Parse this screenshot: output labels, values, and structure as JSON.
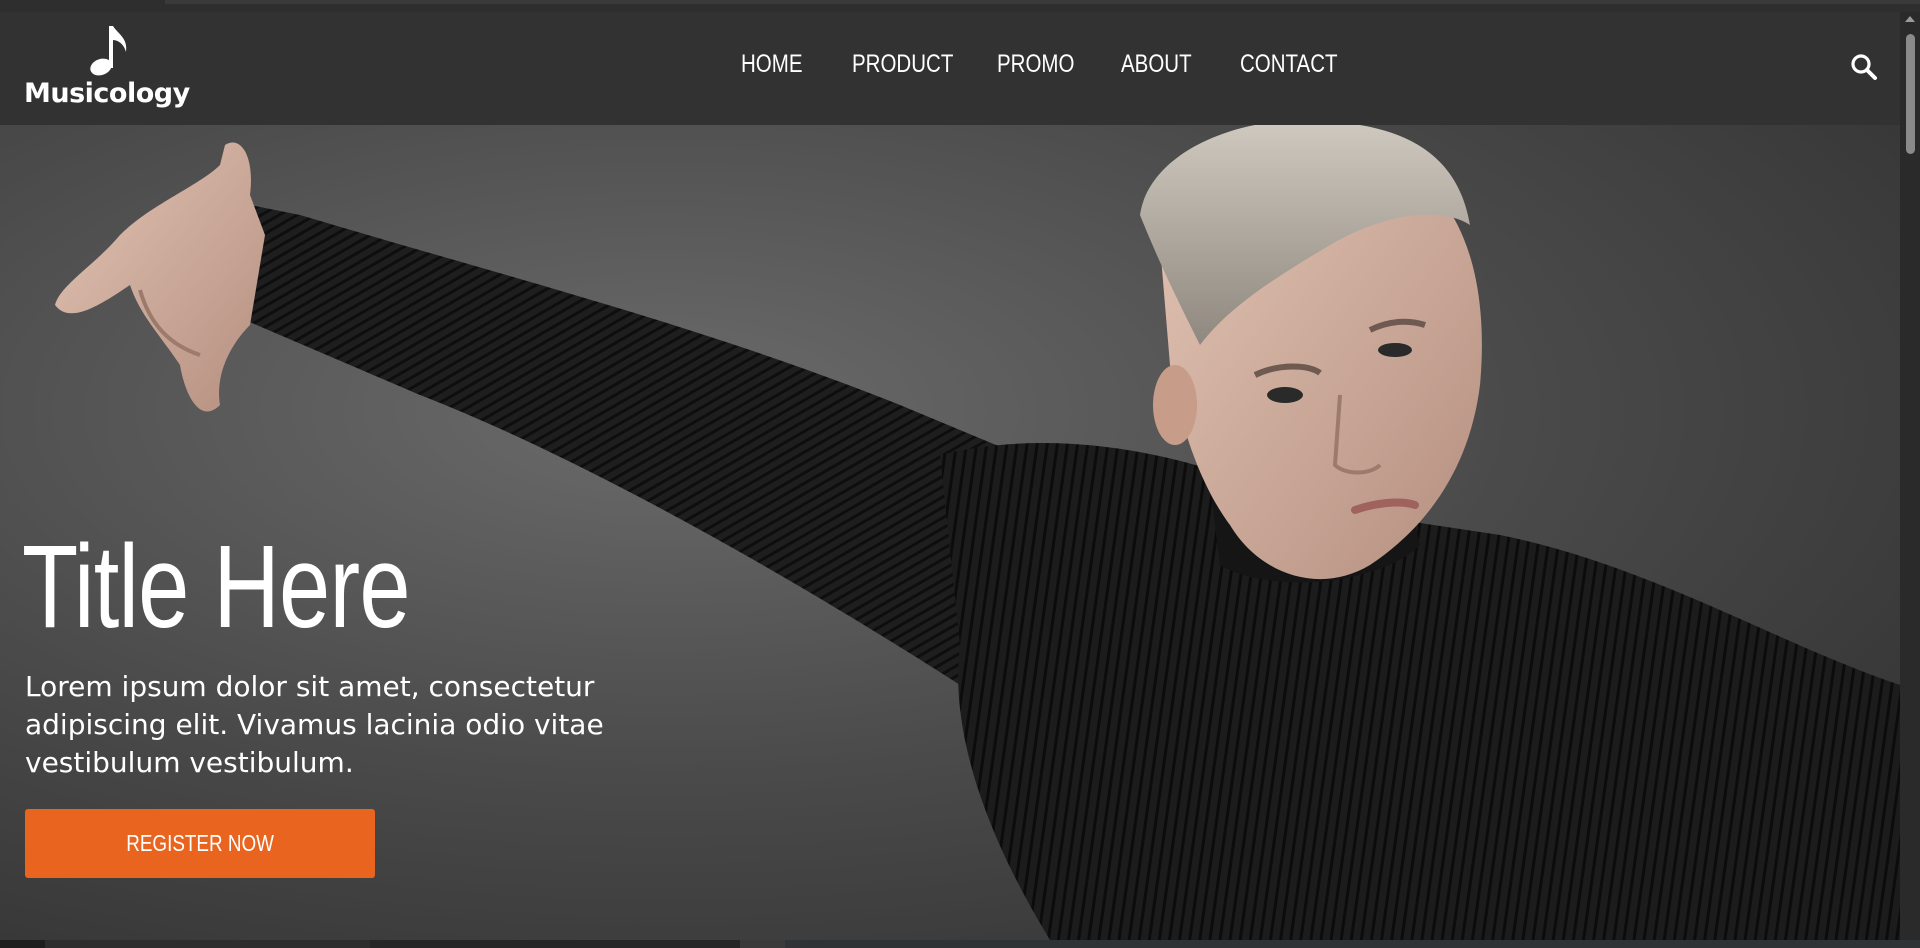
{
  "brand": {
    "name": "Musicology",
    "logo_icon": "music-note-icon"
  },
  "nav": {
    "items": [
      {
        "label": "HOME"
      },
      {
        "label": "PRODUCT"
      },
      {
        "label": "PROMO"
      },
      {
        "label": "ABOUT"
      },
      {
        "label": "CONTACT"
      }
    ],
    "search_icon": "search-icon"
  },
  "hero": {
    "title": "Title Here",
    "text": "Lorem ipsum dolor sit amet, consectetur adipiscing elit. Vivamus lacinia odio vitae vestibulum vestibulum.",
    "cta_label": "REGISTER NOW"
  },
  "colors": {
    "navbar_bg": "#323232",
    "accent": "#e8641f",
    "text": "#ffffff"
  }
}
